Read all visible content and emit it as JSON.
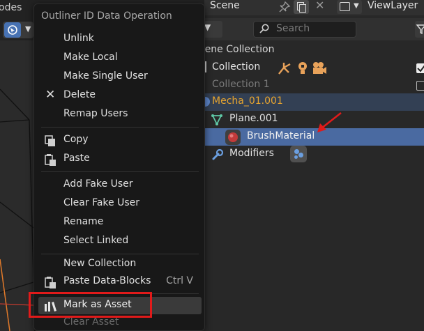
{
  "viewport": {
    "modes_label": "odes"
  },
  "outliner": {
    "scene_label": "Scene",
    "viewlayer_label": "ViewLayer",
    "search": {
      "placeholder": "Search"
    },
    "tree": {
      "scene_collection": "cene Collection",
      "collection": "Collection",
      "collection1": "Collection 1",
      "mecha": "Mecha_01.001",
      "plane": "Plane.001",
      "brush_material": "BrushMaterial",
      "modifiers": "Modifiers"
    },
    "colors": {
      "selected_row": "#4a6aa1",
      "active_object": "#e8a52f",
      "mesh": "#5fc8a6",
      "modifier": "#6b9fe0"
    }
  },
  "menu": {
    "title": "Outliner ID Data Operation",
    "items": {
      "unlink": "Unlink",
      "make_local": "Make Local",
      "make_single_user": "Make Single User",
      "delete": "Delete",
      "remap_users": "Remap Users",
      "copy": "Copy",
      "paste": "Paste",
      "add_fake_user": "Add Fake User",
      "clear_fake_user": "Clear Fake User",
      "rename": "Rename",
      "select_linked": "Select Linked",
      "new_collection": "New Collection",
      "paste_data_blocks": "Paste Data-Blocks",
      "paste_data_blocks_shortcut": "Ctrl V",
      "mark_as_asset": "Mark as Asset",
      "clear_asset": "Clear Asset"
    },
    "hover_color": "#3a3a3a",
    "annotation_color": "#e11a1a"
  }
}
